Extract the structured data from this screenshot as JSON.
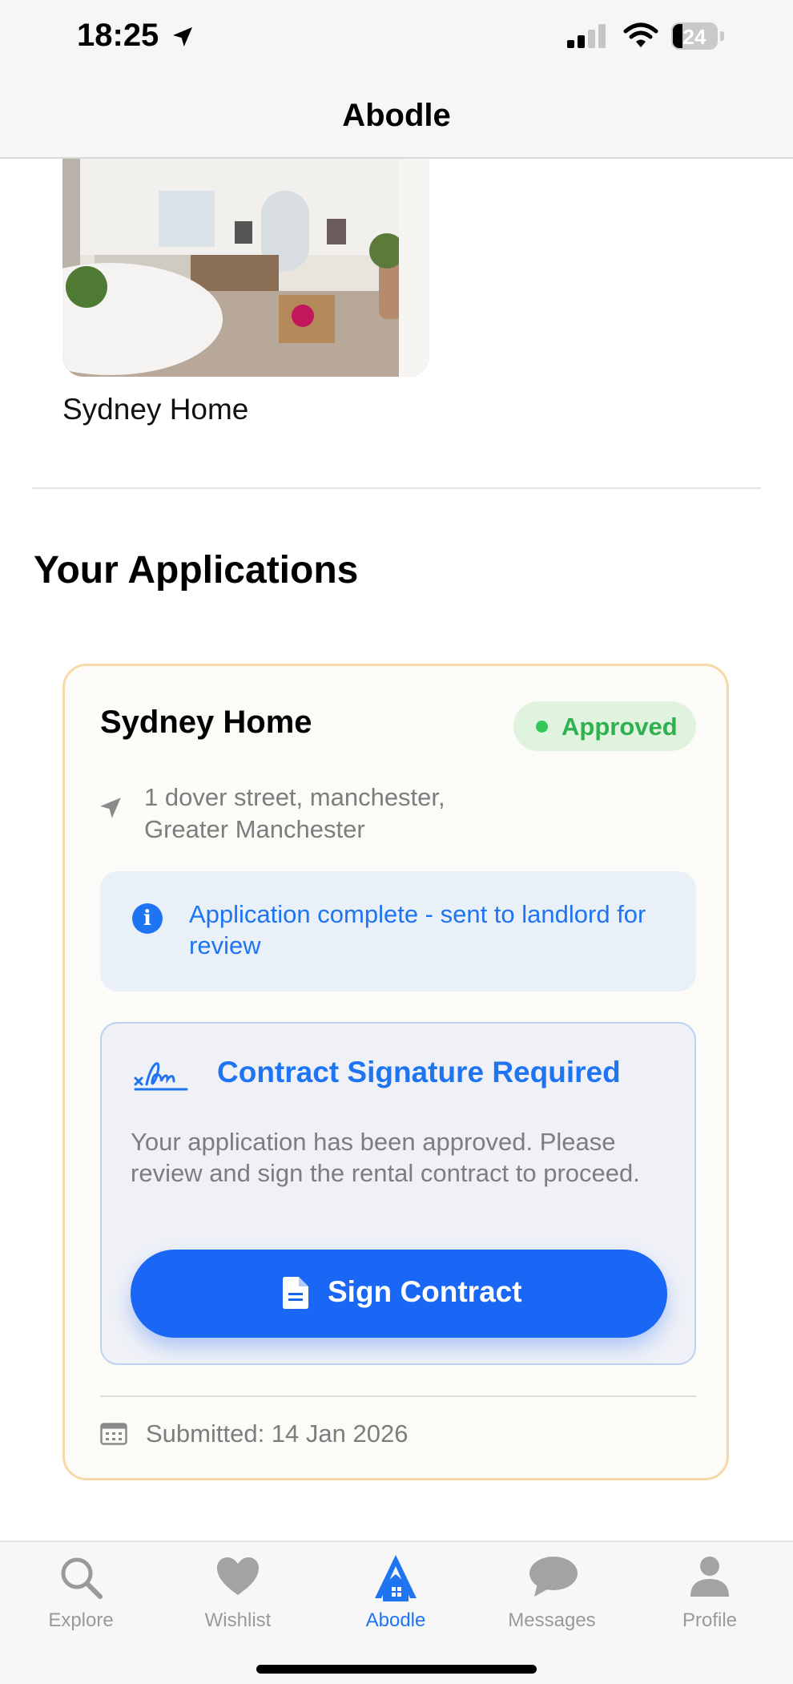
{
  "status_bar": {
    "time": "18:25",
    "battery": "24"
  },
  "header": {
    "title": "Abodle"
  },
  "property": {
    "name": "Sydney Home"
  },
  "applications": {
    "section_title": "Your Applications",
    "items": [
      {
        "title": "Sydney Home",
        "status": "Approved",
        "address_line1": "1 dover street, manchester,",
        "address_line2": "Greater Manchester",
        "info": "Application complete - sent to landlord for review",
        "contract_title": "Contract Signature Required",
        "contract_description": "Your application has been approved. Please review and sign the rental contract to proceed.",
        "sign_button": "Sign Contract",
        "submitted": "Submitted: 14 Jan 2026"
      }
    ]
  },
  "tabs": [
    {
      "label": "Explore",
      "icon": "magnifier-icon",
      "active": false
    },
    {
      "label": "Wishlist",
      "icon": "heart-icon",
      "active": false
    },
    {
      "label": "Abodle",
      "icon": "abodle-house-icon",
      "active": true
    },
    {
      "label": "Messages",
      "icon": "chat-bubble-icon",
      "active": false
    },
    {
      "label": "Profile",
      "icon": "person-icon",
      "active": false
    }
  ],
  "colors": {
    "accent": "#1f74f2",
    "approved": "#34c759",
    "card_border": "#f8d9a6"
  }
}
